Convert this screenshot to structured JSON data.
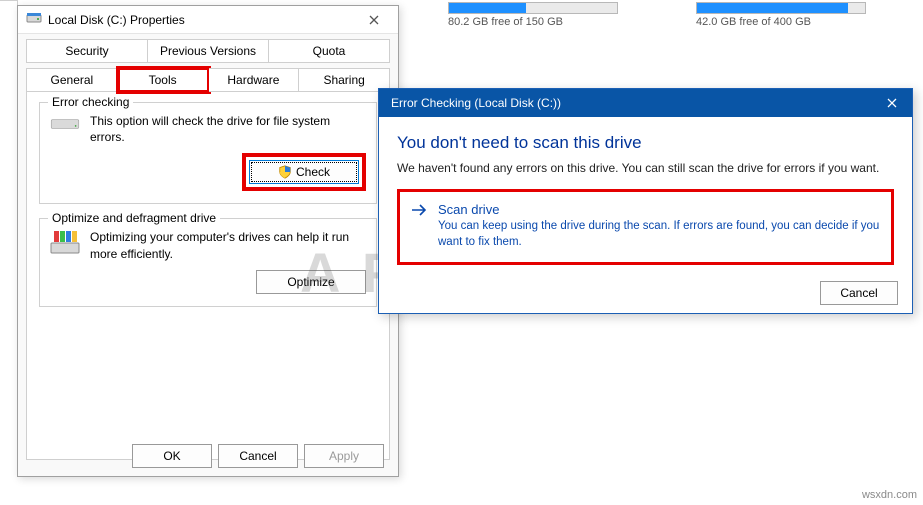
{
  "drives": [
    {
      "label": "80.2 GB free of 150 GB",
      "fill_pct": 46
    },
    {
      "label": "42.0 GB free of 400 GB",
      "fill_pct": 90
    }
  ],
  "prop": {
    "title": "Local Disk (C:) Properties",
    "tabs_row1": [
      "Security",
      "Previous Versions",
      "Quota"
    ],
    "tabs_row2": [
      "General",
      "Tools",
      "Hardware",
      "Sharing"
    ],
    "active_tab": "Tools",
    "error_check": {
      "title": "Error checking",
      "desc": "This option will check the drive for file system errors.",
      "btn": "Check"
    },
    "optimize": {
      "title": "Optimize and defragment drive",
      "desc": "Optimizing your computer's drives can help it run more efficiently.",
      "btn": "Optimize"
    },
    "buttons": {
      "ok": "OK",
      "cancel": "Cancel",
      "apply": "Apply"
    }
  },
  "ec": {
    "title": "Error Checking (Local Disk (C:))",
    "heading": "You don't need to scan this drive",
    "sub": "We haven't found any errors on this drive. You can still scan the drive for errors if you want.",
    "scan_title": "Scan drive",
    "scan_desc": "You can keep using the drive during the scan. If errors are found, you can decide if you want to fix them.",
    "cancel": "Cancel"
  },
  "watermark": "A PUALS",
  "credit": "wsxdn.com"
}
